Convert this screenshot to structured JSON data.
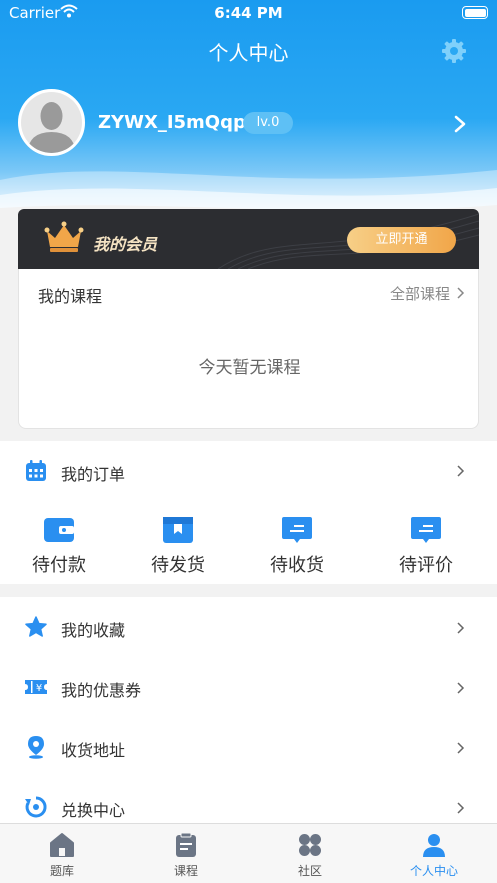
{
  "status_bar": {
    "carrier": "Carrier",
    "time": "6:44 PM"
  },
  "header": {
    "title": "个人中心"
  },
  "profile": {
    "username": "ZYWX_I5mQqp",
    "level": "lv.0"
  },
  "vip": {
    "title": "我的会员",
    "button": "立即开通"
  },
  "courses": {
    "title": "我的课程",
    "all_link": "全部课程",
    "empty_text": "今天暂无课程"
  },
  "orders": {
    "title": "我的订单",
    "items": [
      {
        "label": "待付款",
        "icon": "wallet-icon"
      },
      {
        "label": "待发货",
        "icon": "package-icon"
      },
      {
        "label": "待收货",
        "icon": "receive-icon"
      },
      {
        "label": "待评价",
        "icon": "review-icon"
      }
    ]
  },
  "menu": [
    {
      "label": "我的收藏",
      "icon": "star-icon"
    },
    {
      "label": "我的优惠券",
      "icon": "coupon-icon"
    },
    {
      "label": "收货地址",
      "icon": "location-icon"
    },
    {
      "label": "兑换中心",
      "icon": "exchange-icon"
    }
  ],
  "tabs": [
    {
      "label": "题库",
      "icon": "home-icon"
    },
    {
      "label": "课程",
      "icon": "document-icon"
    },
    {
      "label": "社区",
      "icon": "grid-icon"
    },
    {
      "label": "个人中心",
      "icon": "person-icon",
      "active": true
    }
  ],
  "colors": {
    "primary": "#1a9bf0",
    "accent_blue": "#2a8ff0",
    "vip_bg": "#2c2d31",
    "vip_gold": "#f1a649"
  }
}
